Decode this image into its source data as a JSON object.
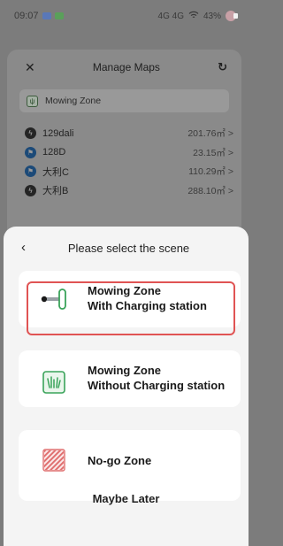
{
  "status_bar": {
    "time": "09:07",
    "signal_text": "4G 4G",
    "battery_text": "43%"
  },
  "background_dialog": {
    "title": "Manage Maps",
    "zone_label": "Mowing Zone",
    "maps": [
      {
        "name": "129dali",
        "area": "201.76㎡",
        "icon": "bolt-icon"
      },
      {
        "name": "128D",
        "area": "23.15㎡",
        "icon": "flag-icon"
      },
      {
        "name": "大利C",
        "area": "110.29㎡",
        "icon": "flag-icon"
      },
      {
        "name": "大利B",
        "area": "288.10㎡",
        "icon": "bolt-icon"
      }
    ],
    "chevron": ">"
  },
  "sheet": {
    "title": "Please select the scene",
    "options": [
      {
        "line1": "Mowing Zone",
        "line2": "With Charging station",
        "icon": "charging-station-icon",
        "selected": true
      },
      {
        "line1": "Mowing Zone",
        "line2": "Without Charging station",
        "icon": "grass-icon",
        "selected": false
      },
      {
        "line1": "No-go Zone",
        "line2": "",
        "icon": "no-go-zone-icon",
        "selected": false
      }
    ],
    "maybe_later": "Maybe Later"
  },
  "colors": {
    "accent_green": "#3aa35a",
    "selection_red": "#e05454",
    "no_go_red": "#e07070"
  }
}
